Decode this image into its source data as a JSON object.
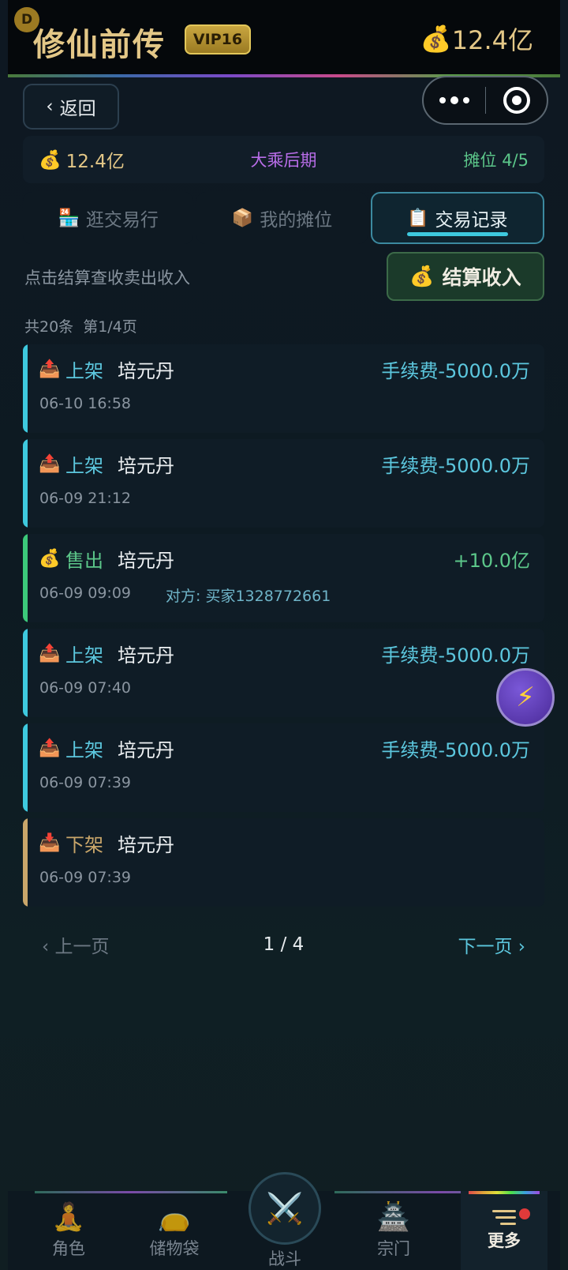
{
  "header": {
    "badge": "D",
    "title": "修仙前传",
    "vip": "VIP16",
    "money": "12.4亿",
    "money_icon": "money-bag-icon"
  },
  "nav": {
    "back_label": "返回",
    "back_chevron": "‹"
  },
  "info": {
    "money": "12.4亿",
    "realm": "大乘后期",
    "stall": "摊位 4/5"
  },
  "tabs": [
    {
      "icon": "🏪",
      "label": "逛交易行",
      "active": false
    },
    {
      "icon": "📦",
      "label": "我的摊位",
      "active": false
    },
    {
      "icon": "📋",
      "label": "交易记录",
      "active": true
    }
  ],
  "settle": {
    "hint": "点击结算查收卖出收入",
    "button": "结算收入"
  },
  "list_meta": {
    "total": "共20条",
    "page": "第1/4页"
  },
  "records": [
    {
      "type": "上架",
      "icon": "📤",
      "item": "培元丹",
      "amount": "手续费-5000.0万",
      "time": "06-10 16:58",
      "party": ""
    },
    {
      "type": "上架",
      "icon": "📤",
      "item": "培元丹",
      "amount": "手续费-5000.0万",
      "time": "06-09 21:12",
      "party": ""
    },
    {
      "type": "售出",
      "icon": "💰",
      "item": "培元丹",
      "amount": "+10.0亿",
      "time": "06-09 09:09",
      "party": "对方: 买家1328772661"
    },
    {
      "type": "上架",
      "icon": "📤",
      "item": "培元丹",
      "amount": "手续费-5000.0万",
      "time": "06-09 07:40",
      "party": ""
    },
    {
      "type": "上架",
      "icon": "📤",
      "item": "培元丹",
      "amount": "手续费-5000.0万",
      "time": "06-09 07:39",
      "party": ""
    },
    {
      "type": "下架",
      "icon": "📥",
      "item": "培元丹",
      "amount": "",
      "time": "06-09 07:39",
      "party": ""
    }
  ],
  "pager": {
    "prev": "‹ 上一页",
    "current": "1 / 4",
    "next": "下一页 ›"
  },
  "float_button": "⚡",
  "bottom_nav": [
    {
      "icon": "🧘",
      "label": "角色"
    },
    {
      "icon": "👝",
      "label": "储物袋"
    },
    {
      "icon": "⚔️",
      "label": "战斗"
    },
    {
      "icon": "🏯",
      "label": "宗门"
    },
    {
      "icon": "menu-icon",
      "label": "更多"
    }
  ],
  "colors": {
    "list_bar": "#3ec9de",
    "sell_bar": "#3cc97a",
    "unlist_bar": "#c9a66a",
    "list_text": "#5cc7de",
    "sell_text": "#5cc78a",
    "unlist_text": "#c9a66a"
  }
}
